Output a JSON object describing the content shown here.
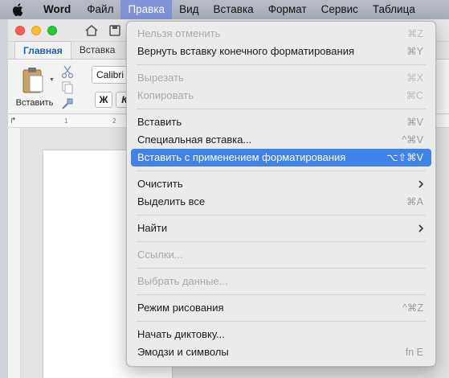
{
  "menubar": {
    "app_name": "Word",
    "items": [
      "Файл",
      "Правка",
      "Вид",
      "Вставка",
      "Формат",
      "Сервис",
      "Таблица"
    ],
    "active_index": 1
  },
  "ribbon": {
    "tabs": [
      "Главная",
      "Вставка"
    ],
    "paste_label": "Вставить",
    "font_name": "Calibri",
    "bold_label": "Ж",
    "italic_label": "К"
  },
  "ruler": {
    "marks": [
      "1",
      "2"
    ]
  },
  "edit_menu": {
    "accent_color": "#3f82ea",
    "items": [
      {
        "label": "Нельзя отменить",
        "shortcut": "⌘Z",
        "disabled": true
      },
      {
        "label": "Вернуть вставку конечного форматирования",
        "shortcut": "⌘Y",
        "disabled": false
      },
      {
        "label": "Вырезать",
        "shortcut": "⌘X",
        "disabled": true
      },
      {
        "label": "Копировать",
        "shortcut": "⌘C",
        "disabled": true
      },
      {
        "label": "Вставить",
        "shortcut": "⌘V",
        "disabled": false
      },
      {
        "label": "Специальная вставка...",
        "shortcut": "^⌘V",
        "disabled": false
      },
      {
        "label": "Вставить с применением форматирования",
        "shortcut": "⌥⇧⌘V",
        "disabled": false,
        "highlighted": true
      },
      {
        "label": "Очистить",
        "shortcut": "",
        "disabled": false,
        "submenu": true
      },
      {
        "label": "Выделить все",
        "shortcut": "⌘A",
        "disabled": false
      },
      {
        "label": "Найти",
        "shortcut": "",
        "disabled": false,
        "submenu": true
      },
      {
        "label": "Ссылки...",
        "shortcut": "",
        "disabled": true
      },
      {
        "label": "Выбрать данные...",
        "shortcut": "",
        "disabled": true
      },
      {
        "label": "Режим рисования",
        "shortcut": "^⌘Z",
        "disabled": false
      },
      {
        "label": "Начать диктовку...",
        "shortcut": "",
        "disabled": false
      },
      {
        "label": "Эмодзи и символы",
        "shortcut": "fn E",
        "disabled": false
      }
    ]
  }
}
